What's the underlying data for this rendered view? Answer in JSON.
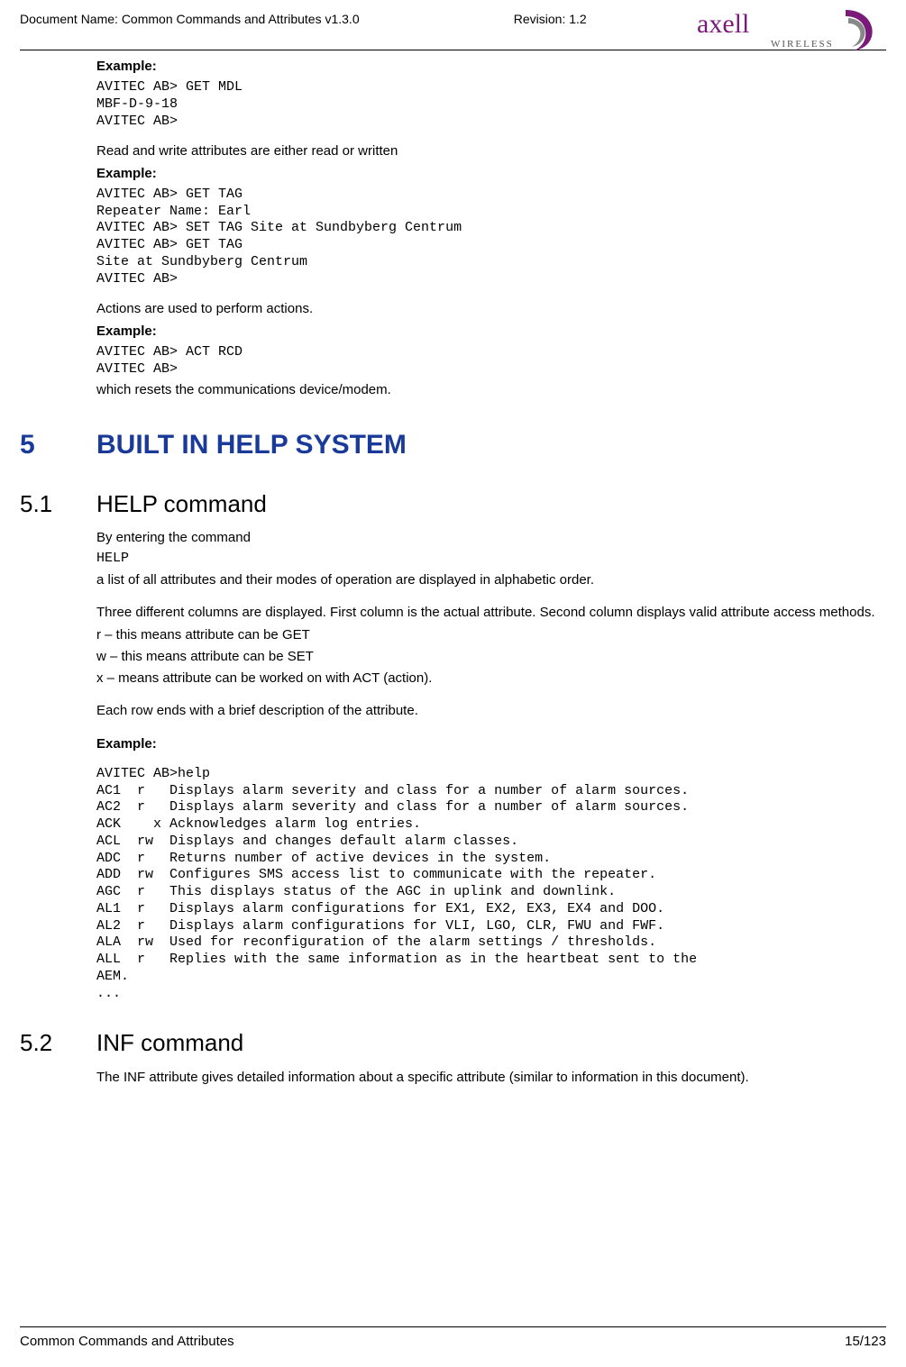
{
  "header": {
    "doc_name": "Document Name: Common Commands and Attributes v1.3.0",
    "revision": "Revision: 1.2",
    "logo_text": "axell",
    "logo_sub": "WIRELESS"
  },
  "example1_label": "Example:",
  "example1_code": "AVITEC AB> GET MDL\nMBF-D-9-18\nAVITEC AB>",
  "rw_text": "Read and write attributes are either read or written",
  "example2_label": "Example:",
  "example2_code": "AVITEC AB> GET TAG\nRepeater Name: Earl\nAVITEC AB> SET TAG Site at Sundbyberg Centrum\nAVITEC AB> GET TAG\nSite at Sundbyberg Centrum\nAVITEC AB>",
  "actions_text": "Actions are used to perform actions.",
  "example3_label": "Example:",
  "example3_code": "AVITEC AB> ACT RCD\nAVITEC AB>",
  "actions_after": "which resets the communications device/modem.",
  "h1_num": "5",
  "h1_title": "BUILT IN HELP SYSTEM",
  "sec51_num": "5.1",
  "sec51_title": "HELP command",
  "sec51_p1": "By entering the command",
  "sec51_help": "HELP",
  "sec51_p2": "a list of all attributes and their modes of operation are displayed in alphabetic order.",
  "sec51_p3a": "Three different columns are displayed. First column is the actual attribute. Second column displays valid attribute access methods.",
  "sec51_p3b": "r – this means attribute can be GET",
  "sec51_p3c": "w – this means attribute can be SET",
  "sec51_p3d": "x – means attribute can be worked on with ACT (action).",
  "sec51_p4": "Each row ends with a brief description of the attribute.",
  "sec51_ex_label": "Example:",
  "sec51_ex_code": "AVITEC AB>help\nAC1  r   Displays alarm severity and class for a number of alarm sources.\nAC2  r   Displays alarm severity and class for a number of alarm sources.\nACK    x Acknowledges alarm log entries.\nACL  rw  Displays and changes default alarm classes.\nADC  r   Returns number of active devices in the system.\nADD  rw  Configures SMS access list to communicate with the repeater.\nAGC  r   This displays status of the AGC in uplink and downlink.\nAL1  r   Displays alarm configurations for EX1, EX2, EX3, EX4 and DOO.\nAL2  r   Displays alarm configurations for VLI, LGO, CLR, FWU and FWF.\nALA  rw  Used for reconfiguration of the alarm settings / thresholds.\nALL  r   Replies with the same information as in the heartbeat sent to the\nAEM.\n...",
  "sec52_num": "5.2",
  "sec52_title": "INF command",
  "sec52_p1": "The INF attribute gives detailed information about a specific attribute (similar to information in this document).",
  "footer": {
    "left": "Common Commands and Attributes",
    "right": "15/123"
  }
}
